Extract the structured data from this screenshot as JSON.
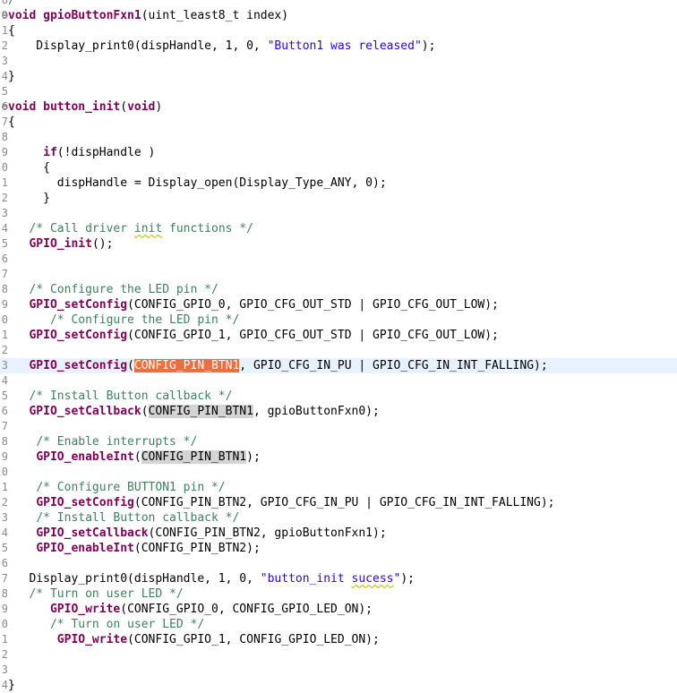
{
  "editor": {
    "lines": [
      {
        "num": "8",
        "fold": "",
        "tokens": [
          {
            "t": "cm",
            "v": "/"
          }
        ]
      },
      {
        "num": "9",
        "fold": "⊖",
        "tokens": [
          {
            "t": "kw",
            "v": "void"
          },
          {
            "t": "",
            "v": " "
          },
          {
            "t": "fn",
            "v": "gpioButtonFxn1"
          },
          {
            "t": "",
            "v": "(uint_least8_t index)"
          }
        ]
      },
      {
        "num": "1",
        "fold": "",
        "tokens": [
          {
            "t": "",
            "v": "{"
          }
        ]
      },
      {
        "num": "2",
        "fold": "",
        "tokens": [
          {
            "t": "",
            "v": "    Display_print0(dispHandle, 1, 0, "
          },
          {
            "t": "str",
            "v": "\"Button1 was released\""
          },
          {
            "t": "",
            "v": ");"
          }
        ]
      },
      {
        "num": "3",
        "fold": "",
        "tokens": []
      },
      {
        "num": "4",
        "fold": "",
        "tokens": [
          {
            "t": "",
            "v": "}"
          }
        ]
      },
      {
        "num": "5",
        "fold": "",
        "tokens": []
      },
      {
        "num": "6",
        "fold": "⊖",
        "tokens": [
          {
            "t": "kw",
            "v": "void"
          },
          {
            "t": "",
            "v": " "
          },
          {
            "t": "fn",
            "v": "button_init"
          },
          {
            "t": "",
            "v": "("
          },
          {
            "t": "kw",
            "v": "void"
          },
          {
            "t": "",
            "v": ")"
          }
        ]
      },
      {
        "num": "7",
        "fold": "",
        "tokens": [
          {
            "t": "",
            "v": "{"
          }
        ]
      },
      {
        "num": "8",
        "fold": "",
        "tokens": []
      },
      {
        "num": "9",
        "fold": "",
        "tokens": [
          {
            "t": "",
            "v": "     "
          },
          {
            "t": "kw",
            "v": "if"
          },
          {
            "t": "",
            "v": "(!dispHandle )"
          }
        ]
      },
      {
        "num": "0",
        "fold": "",
        "tokens": [
          {
            "t": "",
            "v": "     {"
          }
        ]
      },
      {
        "num": "1",
        "fold": "",
        "tokens": [
          {
            "t": "",
            "v": "       dispHandle = Display_open(Display_Type_ANY, 0);"
          }
        ]
      },
      {
        "num": "2",
        "fold": "",
        "tokens": [
          {
            "t": "",
            "v": "     }"
          }
        ]
      },
      {
        "num": "3",
        "fold": "",
        "tokens": []
      },
      {
        "num": "4",
        "fold": "",
        "tokens": [
          {
            "t": "",
            "v": "   "
          },
          {
            "t": "cm",
            "v": "/* Call driver "
          },
          {
            "t": "cm sp",
            "v": "init"
          },
          {
            "t": "cm",
            "v": " functions */"
          }
        ]
      },
      {
        "num": "5",
        "fold": "",
        "tokens": [
          {
            "t": "",
            "v": "   "
          },
          {
            "t": "fn",
            "v": "GPIO_init"
          },
          {
            "t": "",
            "v": "();"
          }
        ]
      },
      {
        "num": "6",
        "fold": "",
        "tokens": []
      },
      {
        "num": "7",
        "fold": "",
        "tokens": []
      },
      {
        "num": "8",
        "fold": "",
        "tokens": [
          {
            "t": "",
            "v": "   "
          },
          {
            "t": "cm",
            "v": "/* Configure the LED pin */"
          }
        ]
      },
      {
        "num": "9",
        "fold": "",
        "tokens": [
          {
            "t": "",
            "v": "   "
          },
          {
            "t": "fn",
            "v": "GPIO_setConfig"
          },
          {
            "t": "",
            "v": "(CONFIG_GPIO_0, GPIO_CFG_OUT_STD | GPIO_CFG_OUT_LOW);"
          }
        ]
      },
      {
        "num": "0",
        "fold": "",
        "tokens": [
          {
            "t": "",
            "v": "      "
          },
          {
            "t": "cm",
            "v": "/* Configure the LED pin */"
          }
        ]
      },
      {
        "num": "1",
        "fold": "",
        "tokens": [
          {
            "t": "",
            "v": "   "
          },
          {
            "t": "fn",
            "v": "GPIO_setConfig"
          },
          {
            "t": "",
            "v": "(CONFIG_GPIO_1, GPIO_CFG_OUT_STD | GPIO_CFG_OUT_LOW);"
          }
        ]
      },
      {
        "num": "2",
        "fold": "",
        "tokens": []
      },
      {
        "num": "3",
        "fold": "",
        "hl": true,
        "tokens": [
          {
            "t": "",
            "v": "   "
          },
          {
            "t": "fn",
            "v": "GPIO_setConfig"
          },
          {
            "t": "",
            "v": "("
          },
          {
            "t": "occ-sel",
            "v": "CONFIG_PIN_BTN1"
          },
          {
            "t": "",
            "v": ", GPIO_CFG_IN_PU | GPIO_CFG_IN_INT_FALLING);"
          }
        ]
      },
      {
        "num": "4",
        "fold": "",
        "tokens": []
      },
      {
        "num": "5",
        "fold": "",
        "tokens": [
          {
            "t": "",
            "v": "   "
          },
          {
            "t": "cm",
            "v": "/* Install Button callback */"
          }
        ]
      },
      {
        "num": "6",
        "fold": "",
        "tokens": [
          {
            "t": "",
            "v": "   "
          },
          {
            "t": "fn",
            "v": "GPIO_setCallback"
          },
          {
            "t": "",
            "v": "("
          },
          {
            "t": "occ",
            "v": "CONFIG_PIN_BTN1"
          },
          {
            "t": "",
            "v": ", gpioButtonFxn0);"
          }
        ]
      },
      {
        "num": "7",
        "fold": "",
        "tokens": []
      },
      {
        "num": "8",
        "fold": "",
        "tokens": [
          {
            "t": "",
            "v": "    "
          },
          {
            "t": "cm",
            "v": "/* Enable interrupts */"
          }
        ]
      },
      {
        "num": "9",
        "fold": "",
        "tokens": [
          {
            "t": "",
            "v": "    "
          },
          {
            "t": "fn",
            "v": "GPIO_enableInt"
          },
          {
            "t": "",
            "v": "("
          },
          {
            "t": "occ",
            "v": "CONFIG_PIN_BTN1"
          },
          {
            "t": "",
            "v": ");"
          }
        ]
      },
      {
        "num": "0",
        "fold": "",
        "tokens": []
      },
      {
        "num": "1",
        "fold": "",
        "tokens": [
          {
            "t": "",
            "v": "    "
          },
          {
            "t": "cm",
            "v": "/* Configure BUTTON1 pin */"
          }
        ]
      },
      {
        "num": "2",
        "fold": "",
        "tokens": [
          {
            "t": "",
            "v": "    "
          },
          {
            "t": "fn",
            "v": "GPIO_setConfig"
          },
          {
            "t": "",
            "v": "(CONFIG_PIN_BTN2, GPIO_CFG_IN_PU | GPIO_CFG_IN_INT_FALLING);"
          }
        ]
      },
      {
        "num": "3",
        "fold": "",
        "tokens": [
          {
            "t": "",
            "v": "    "
          },
          {
            "t": "cm",
            "v": "/* Install Button callback */"
          }
        ]
      },
      {
        "num": "4",
        "fold": "",
        "tokens": [
          {
            "t": "",
            "v": "    "
          },
          {
            "t": "fn",
            "v": "GPIO_setCallback"
          },
          {
            "t": "",
            "v": "(CONFIG_PIN_BTN2, gpioButtonFxn1);"
          }
        ]
      },
      {
        "num": "5",
        "fold": "",
        "tokens": [
          {
            "t": "",
            "v": "    "
          },
          {
            "t": "fn",
            "v": "GPIO_enableInt"
          },
          {
            "t": "",
            "v": "(CONFIG_PIN_BTN2);"
          }
        ]
      },
      {
        "num": "6",
        "fold": "",
        "tokens": []
      },
      {
        "num": "7",
        "fold": "",
        "tokens": [
          {
            "t": "",
            "v": "   Display_print0(dispHandle, 1, 0, "
          },
          {
            "t": "str",
            "v": "\"button_init "
          },
          {
            "t": "str sp",
            "v": "sucess"
          },
          {
            "t": "str",
            "v": "\""
          },
          {
            "t": "",
            "v": ");"
          }
        ]
      },
      {
        "num": "8",
        "fold": "",
        "tokens": [
          {
            "t": "",
            "v": "   "
          },
          {
            "t": "cm",
            "v": "/* Turn on user LED */"
          }
        ]
      },
      {
        "num": "9",
        "fold": "",
        "tokens": [
          {
            "t": "",
            "v": "      "
          },
          {
            "t": "fn",
            "v": "GPIO_write"
          },
          {
            "t": "",
            "v": "(CONFIG_GPIO_0, CONFIG_GPIO_LED_ON);"
          }
        ]
      },
      {
        "num": "0",
        "fold": "",
        "tokens": [
          {
            "t": "",
            "v": "      "
          },
          {
            "t": "cm",
            "v": "/* Turn on user LED */"
          }
        ]
      },
      {
        "num": "1",
        "fold": "",
        "tokens": [
          {
            "t": "",
            "v": "       "
          },
          {
            "t": "fn",
            "v": "GPIO_write"
          },
          {
            "t": "",
            "v": "(CONFIG_GPIO_1, CONFIG_GPIO_LED_ON);"
          }
        ]
      },
      {
        "num": "2",
        "fold": "",
        "tokens": []
      },
      {
        "num": "3",
        "fold": "",
        "tokens": []
      },
      {
        "num": "4",
        "fold": "",
        "tokens": [
          {
            "t": "",
            "v": "}"
          }
        ]
      }
    ]
  }
}
